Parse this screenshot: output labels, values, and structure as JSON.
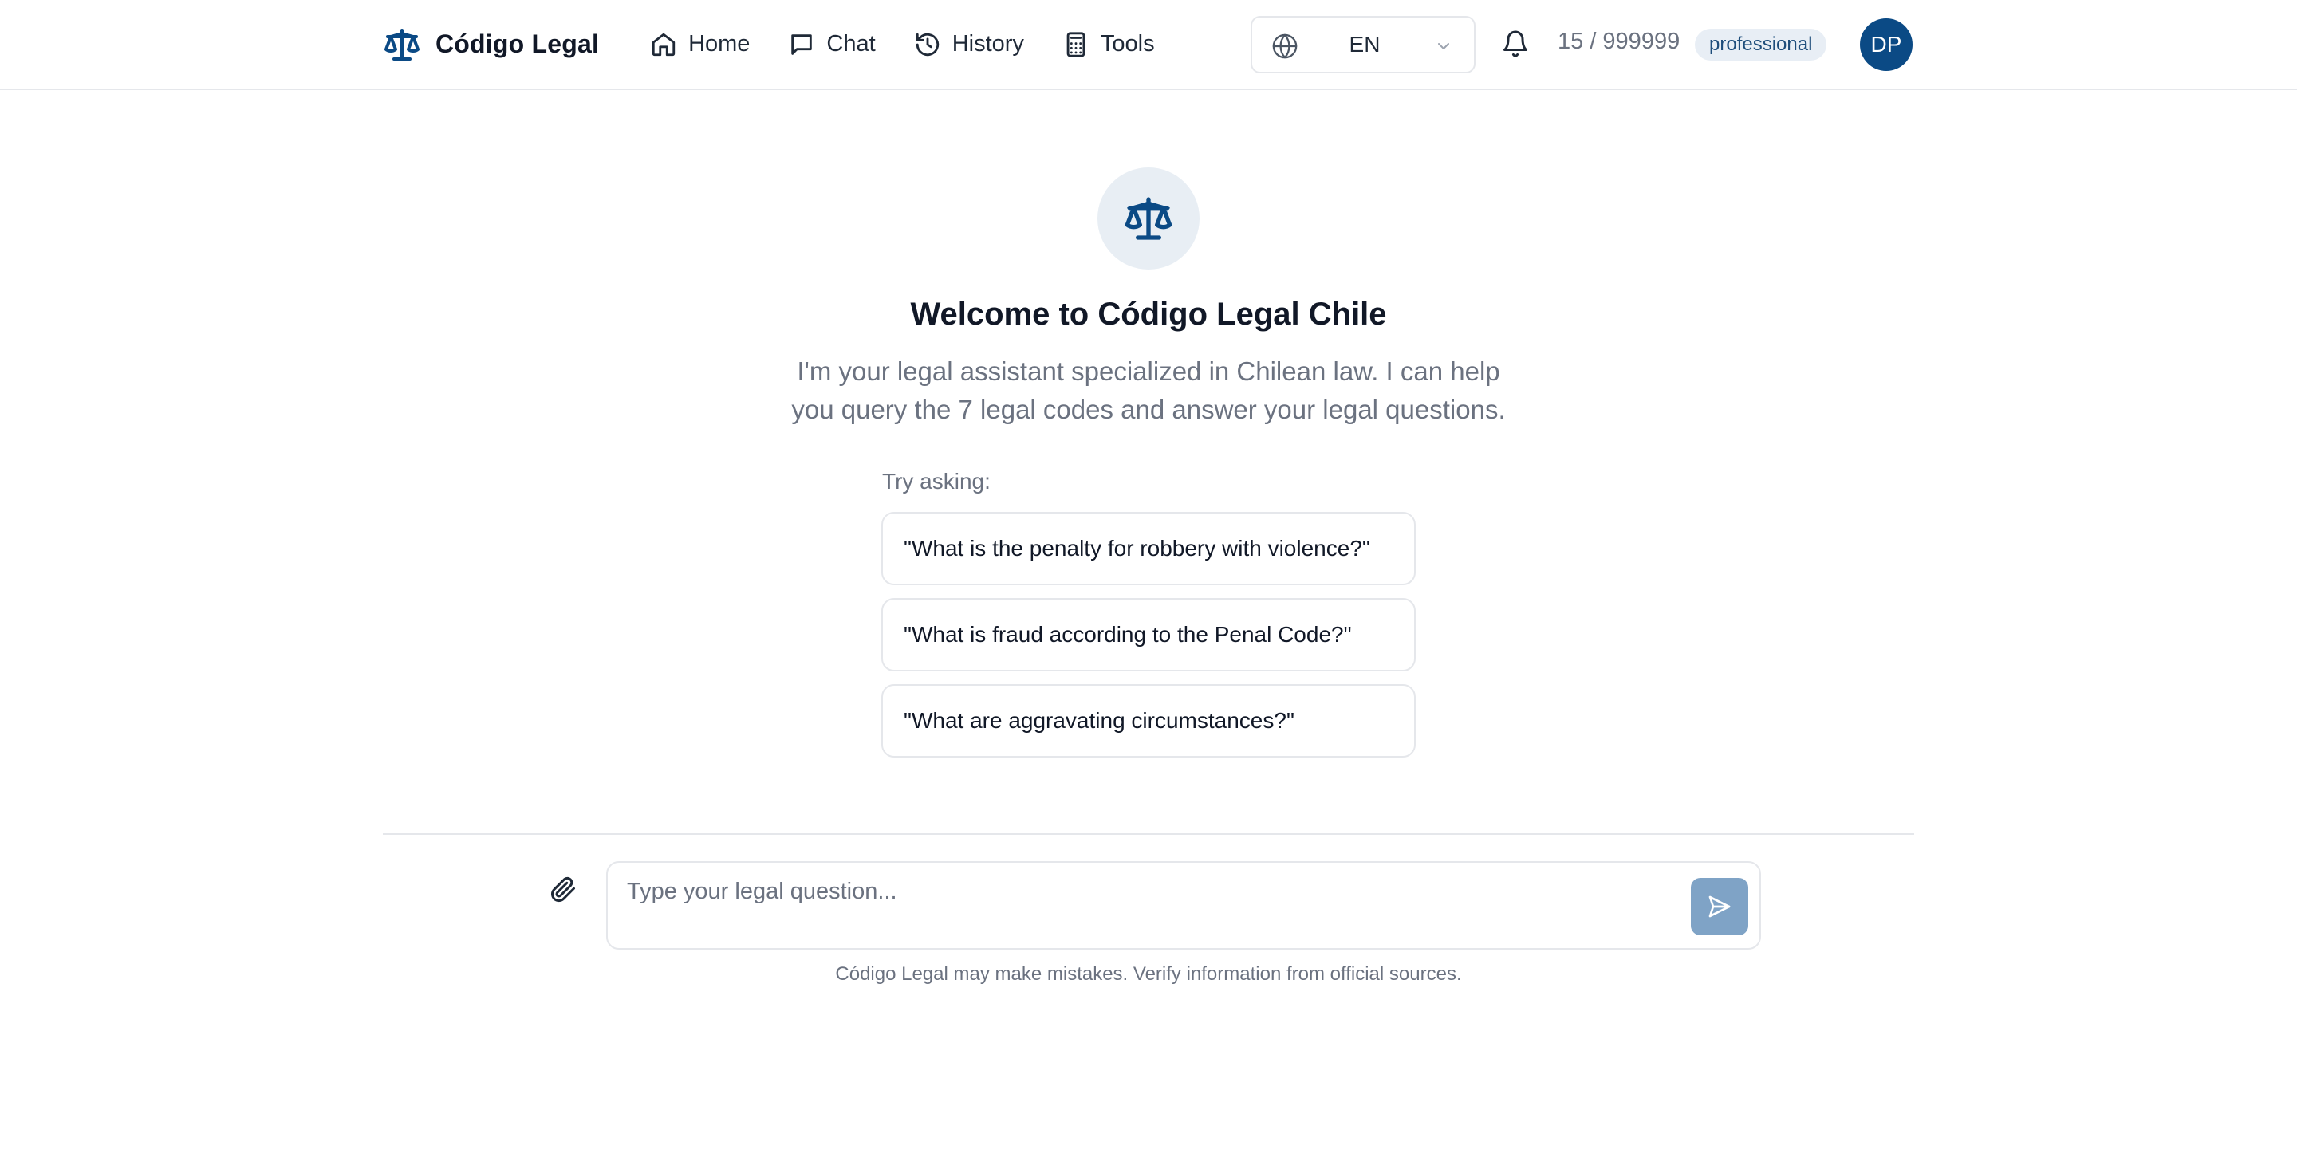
{
  "header": {
    "brand": "Código Legal",
    "nav": [
      {
        "label": "Home",
        "icon": "home-icon"
      },
      {
        "label": "Chat",
        "icon": "chat-icon"
      },
      {
        "label": "History",
        "icon": "history-icon"
      },
      {
        "label": "Tools",
        "icon": "calculator-icon"
      }
    ],
    "language": {
      "value": "EN",
      "icon": "globe-icon"
    },
    "notifications_icon": "bell-icon",
    "usage": "15 / 999999",
    "plan": "professional",
    "avatar_initials": "DP"
  },
  "welcome": {
    "icon": "scales-icon",
    "title": "Welcome to Código Legal Chile",
    "description": "I'm your legal assistant specialized in Chilean law. I can help you query the 7 legal codes and answer your legal questions.",
    "try_label": "Try asking:",
    "suggestions": [
      "\"What is the penalty for robbery with violence?\"",
      "\"What is fraud according to the Penal Code?\"",
      "\"What are aggravating circumstances?\""
    ]
  },
  "composer": {
    "placeholder": "Type your legal question...",
    "value": "",
    "attach_icon": "paperclip-icon",
    "send_icon": "send-icon"
  },
  "disclaimer": "Código Legal may make mistakes. Verify information from official sources.",
  "colors": {
    "brand": "#0b4a85",
    "send_button": "#7fa3c6",
    "badge_bg": "#e8eef5",
    "border": "#e5e7eb",
    "muted_text": "#6b7280"
  }
}
